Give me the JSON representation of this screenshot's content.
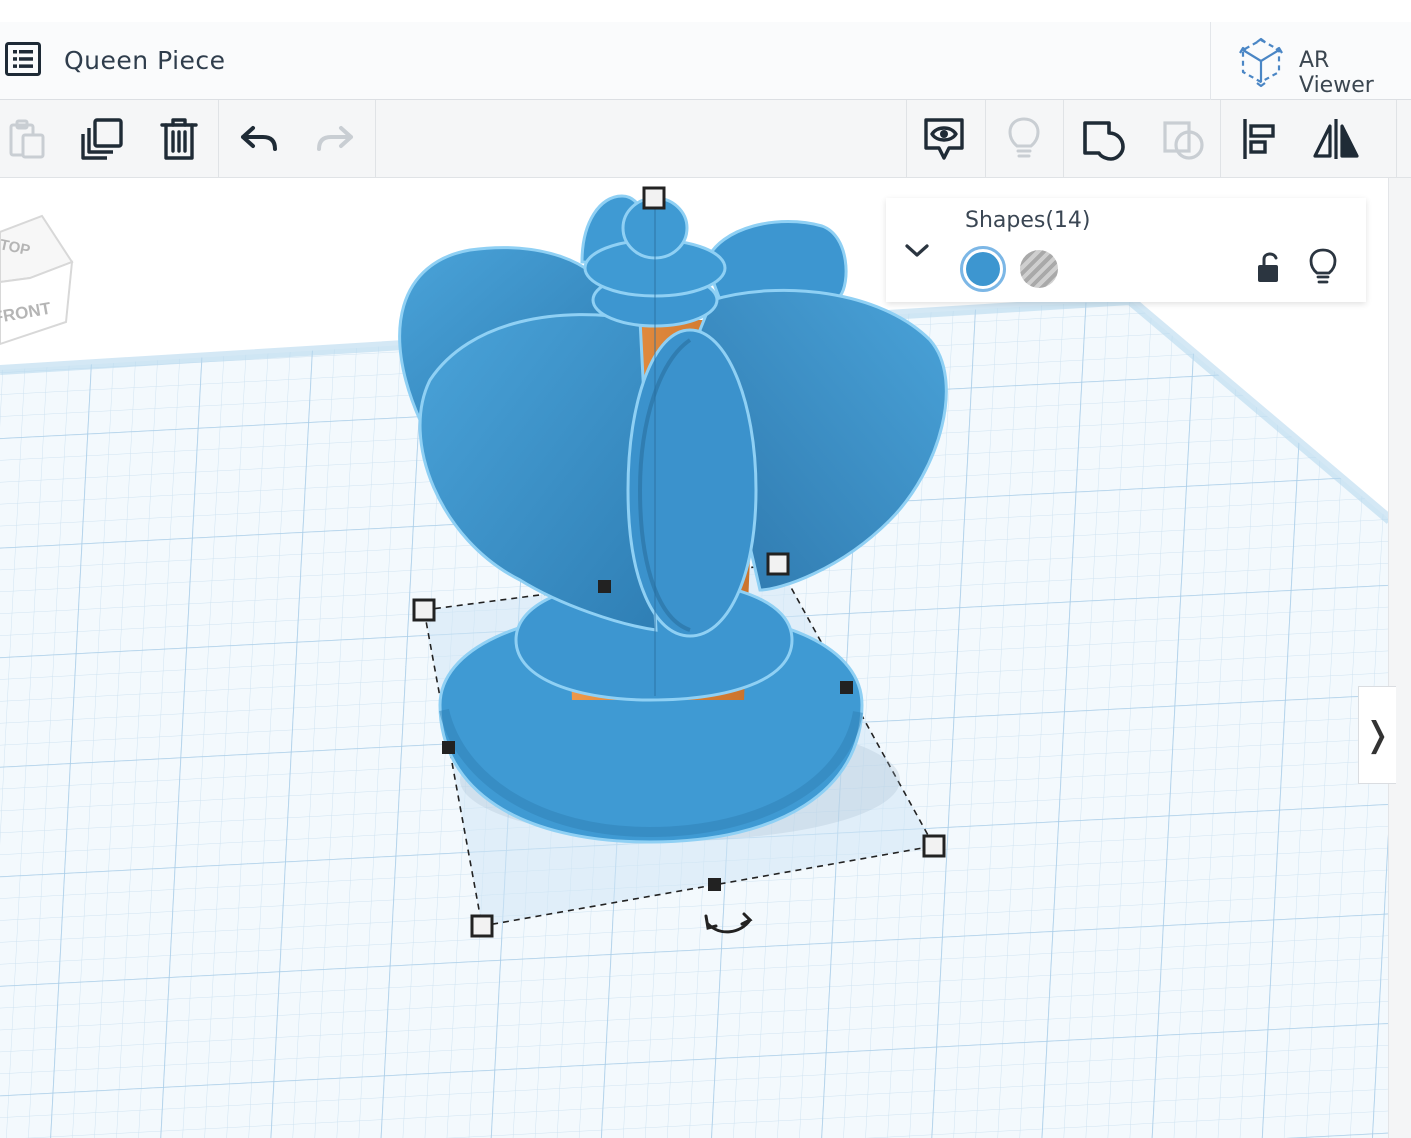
{
  "header": {
    "menu_icon": "list-icon",
    "title": "Queen Piece",
    "ar_viewer_label": "AR Viewer",
    "ar_icon": "ar-cube-icon"
  },
  "toolbar": {
    "buttons": [
      {
        "name": "paste",
        "icon": "paste-icon",
        "enabled": false
      },
      {
        "name": "duplicate",
        "icon": "duplicate-icon",
        "enabled": true
      },
      {
        "name": "delete",
        "icon": "trash-icon",
        "enabled": true
      },
      {
        "name": "undo",
        "icon": "undo-icon",
        "enabled": true
      },
      {
        "name": "redo",
        "icon": "redo-icon",
        "enabled": false
      },
      {
        "name": "notes",
        "icon": "comment-eye-icon",
        "enabled": true
      },
      {
        "name": "show-all",
        "icon": "lightbulb-icon",
        "enabled": false
      },
      {
        "name": "group",
        "icon": "group-icon",
        "enabled": true
      },
      {
        "name": "ungroup",
        "icon": "ungroup-icon",
        "enabled": false
      },
      {
        "name": "align",
        "icon": "align-icon",
        "enabled": true
      },
      {
        "name": "mirror",
        "icon": "mirror-icon",
        "enabled": true
      }
    ]
  },
  "view_cube": {
    "top_label": "TOP",
    "front_label": "FRONT"
  },
  "shapes_panel": {
    "title": "Shapes(14)",
    "toggle_icon": "chevron-down-icon",
    "solid_color": "#3d96d0",
    "hole_swatch": "hole-pattern",
    "lock_icon": "unlock-icon",
    "visibility_icon": "lightbulb-icon"
  },
  "right_tab": {
    "label": "❭"
  },
  "colors": {
    "shape_blue": "#3b94cc",
    "shape_orange": "#e08a3c",
    "workplane_grid": "#bcd9ee",
    "selection": "#333333"
  }
}
